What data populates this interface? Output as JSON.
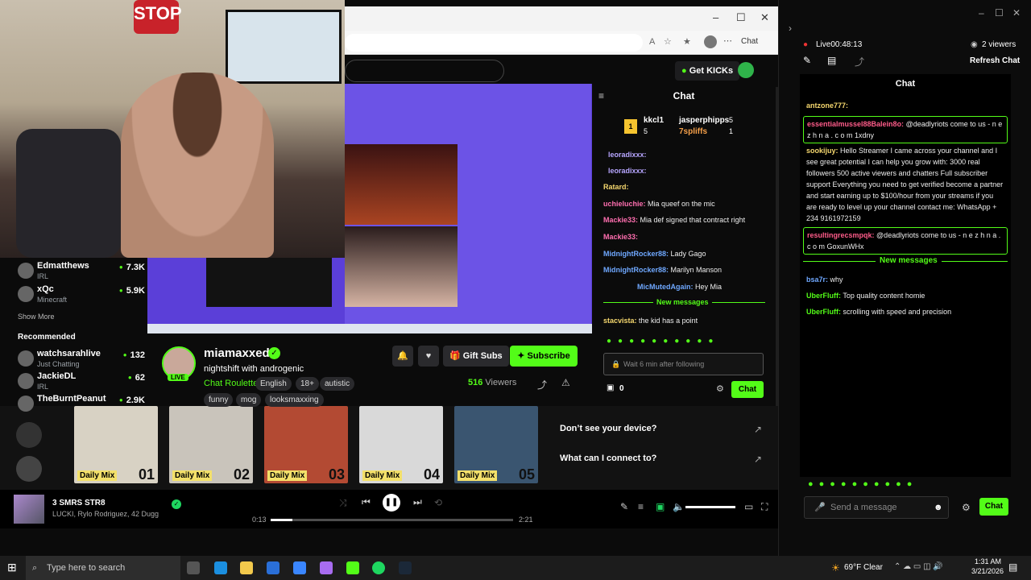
{
  "webcam": {
    "stop_sign": "STOP"
  },
  "browser": {
    "window_controls": [
      "–",
      "☐",
      "✕"
    ],
    "copilot_label": "Chat",
    "get_kicks": "Get KICKs"
  },
  "sidebar": {
    "following": [
      {
        "name": "Edmatthews",
        "category": "IRL",
        "viewers": "7.3K"
      },
      {
        "name": "xQc",
        "category": "Minecraft",
        "viewers": "5.9K"
      }
    ],
    "show_more": "Show More",
    "recommended_heading": "Recommended",
    "recommended": [
      {
        "name": "watchsarahlive",
        "category": "Just Chatting",
        "viewers": "132"
      },
      {
        "name": "JackieDL",
        "category": "IRL",
        "viewers": "62"
      },
      {
        "name": "TheBurntPeanut",
        "category": "",
        "viewers": "2.9K"
      }
    ]
  },
  "stream": {
    "streamer": "miamaxxed",
    "live_badge": "LIVE",
    "title": "nightshift with androgenic",
    "category": "Chat Roulette",
    "tags": [
      "English",
      "18+",
      "autistic",
      "funny",
      "mog",
      "looksmaxxing"
    ],
    "gift_subs": "Gift Subs",
    "subscribe": "Subscribe",
    "viewers_count": "516",
    "viewers_label": "Viewers"
  },
  "kick_chat": {
    "title": "Chat",
    "leaderboard": [
      {
        "rank": "1",
        "name": "kkcl1",
        "count": "5"
      },
      {
        "name": "jasperphipps",
        "count": "5"
      },
      {
        "name": "7spliffs",
        "count": "1"
      }
    ],
    "messages": [
      {
        "user": "leoradixxx:",
        "text": "",
        "color": "#b7a6ff"
      },
      {
        "user": "leoradixxx:",
        "text": "",
        "color": "#b7a6ff"
      },
      {
        "user": "Ratard:",
        "text": "",
        "color": "#f5d76e"
      },
      {
        "user": "uchieluchie:",
        "text": "Mia queef on the mic",
        "color": "#ff6fb0"
      },
      {
        "user": "Mackie33:",
        "text": "Mia def signed that contract right",
        "color": "#ff6fb0"
      },
      {
        "user": "Mackie33:",
        "text": "",
        "color": "#ff6fb0"
      },
      {
        "user": "MidnightRocker88:",
        "text": "Lady Gago",
        "color": "#6fa8ff"
      },
      {
        "user": "MidnightRocker88:",
        "text": "Marilyn Manson",
        "color": "#6fa8ff"
      },
      {
        "user": "MicMutedAgain:",
        "text": "Hey Mia",
        "color": "#6fa8ff"
      },
      {
        "user": "stacvista:",
        "text": "the kid has a point",
        "color": "#f5d76e"
      }
    ],
    "new_messages": "New messages",
    "input_placeholder": "Wait 6 min after following",
    "points": "0",
    "send": "Chat"
  },
  "spotify": {
    "mixes": [
      {
        "label": "Daily Mix",
        "num": "01",
        "color": "#d8d2c4"
      },
      {
        "label": "Daily Mix",
        "num": "02",
        "color": "#c9c4bb"
      },
      {
        "label": "Daily Mix",
        "num": "03",
        "color": "#b34a33"
      },
      {
        "label": "Daily Mix",
        "num": "04",
        "color": "#d9d9d9"
      },
      {
        "label": "Daily Mix",
        "num": "05",
        "color": "#3a5570"
      }
    ],
    "device_prompt": "Don’t see your device?",
    "connect_prompt": "What can I connect to?",
    "track_title": "3 SMRS STR8",
    "track_artist": "LUCKI, Rylo Rodriguez, 42 Dugg",
    "elapsed": "0:13",
    "duration": "2:21",
    "progress": 0.09,
    "volume": 1.0
  },
  "popout": {
    "window_controls": [
      "–",
      "☐",
      "✕"
    ],
    "live_timer": "Live00:48:13",
    "viewers": "2 viewers",
    "refresh": "Refresh Chat",
    "title": "Chat",
    "messages": [
      {
        "user": "antzone777:",
        "text": "",
        "color": "#f5d76e",
        "boxed": false
      },
      {
        "user": "essentialmussel88Balein8o:",
        "text": "@deadlyriots come to us - n e z h n a . c o m 1xdny",
        "color": "#ff5c8a",
        "boxed": true
      },
      {
        "user": "sookijuy:",
        "text": "Hello Streamer I came across your channel and I see great potential I can help you grow with: 3000 real followers 500 active viewers and chatters Full subscriber support Everything you need to get verified become a partner and start earning up to $100/hour from your streams if you are ready to level up your channel contact me: WhatsApp + 234 9161972159",
        "color": "#f5d76e",
        "boxed": false
      },
      {
        "user": "resultingrecsmpqk:",
        "text": "@deadlyriots come to us - n e z h n a . c o m GoxunWHx",
        "color": "#ff5c8a",
        "boxed": true
      },
      {
        "user": "bsa7r:",
        "text": "why",
        "color": "#6fa8ff",
        "boxed": false
      },
      {
        "user": "UberFluff:",
        "text": "Top quality content homie",
        "color": "#53fc18",
        "boxed": false
      },
      {
        "user": "UberFluff:",
        "text": "scrolling with speed and precision",
        "color": "#53fc18",
        "boxed": false
      }
    ],
    "new_messages": "New messages",
    "input_placeholder": "Send a message",
    "send": "Chat"
  },
  "taskbar": {
    "search_placeholder": "Type here to search",
    "weather": "69°F  Clear",
    "time": "1:31 AM",
    "date": "3/21/2026"
  }
}
